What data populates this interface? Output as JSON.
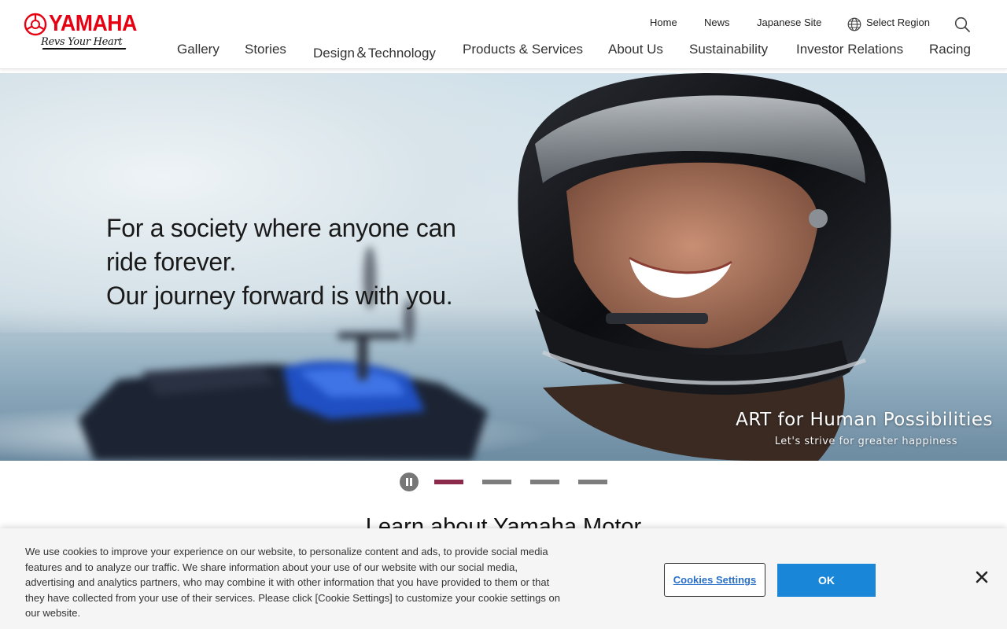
{
  "logo": {
    "brand": "YAMAHA",
    "tagline": "Revs Your Heart"
  },
  "util_nav": [
    {
      "label": "Home"
    },
    {
      "label": "News"
    },
    {
      "label": "Japanese Site"
    },
    {
      "label": "Select Region"
    }
  ],
  "main_nav": [
    {
      "label": "Gallery"
    },
    {
      "label": "Stories"
    },
    {
      "label": "Design＆Technology"
    },
    {
      "label": "Products & Services"
    },
    {
      "label": "About Us"
    },
    {
      "label": "Sustainability"
    },
    {
      "label": "Investor Relations"
    },
    {
      "label": "Racing"
    }
  ],
  "hero": {
    "lines": [
      "For a society where anyone can",
      "ride forever.",
      "Our journey forward is with you."
    ],
    "tagline_main": "ART for Human Possibilities",
    "tagline_sub": "Let's strive for greater happiness"
  },
  "carousel": {
    "slide_count": 4,
    "active_index": 0,
    "state": "playing"
  },
  "section_title": "Learn about Yamaha Motor",
  "cookie": {
    "text": "We use cookies to improve your experience on our website, to personalize content and ads, to provide social media features and to analyze our traffic. We share information about your use of our website with our social media, advertising and analytics partners, who may combine it with other information that you have provided to them or that they have collected from your use of their services. Please click [Cookie Settings] to customize your cookie settings on our website.",
    "settings_label": "Cookies Settings",
    "ok_label": "OK"
  },
  "colors": {
    "brand_red": "#e60012",
    "carousel_active": "#8b2a4a",
    "ok_button": "#1a86d8",
    "settings_link": "#2a70c8"
  }
}
